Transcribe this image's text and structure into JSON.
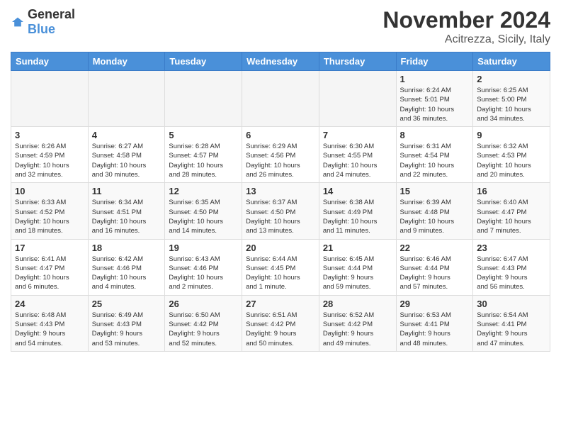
{
  "logo": {
    "general": "General",
    "blue": "Blue"
  },
  "title": "November 2024",
  "location": "Acitrezza, Sicily, Italy",
  "headers": [
    "Sunday",
    "Monday",
    "Tuesday",
    "Wednesday",
    "Thursday",
    "Friday",
    "Saturday"
  ],
  "weeks": [
    [
      {
        "num": "",
        "info": ""
      },
      {
        "num": "",
        "info": ""
      },
      {
        "num": "",
        "info": ""
      },
      {
        "num": "",
        "info": ""
      },
      {
        "num": "",
        "info": ""
      },
      {
        "num": "1",
        "info": "Sunrise: 6:24 AM\nSunset: 5:01 PM\nDaylight: 10 hours\nand 36 minutes."
      },
      {
        "num": "2",
        "info": "Sunrise: 6:25 AM\nSunset: 5:00 PM\nDaylight: 10 hours\nand 34 minutes."
      }
    ],
    [
      {
        "num": "3",
        "info": "Sunrise: 6:26 AM\nSunset: 4:59 PM\nDaylight: 10 hours\nand 32 minutes."
      },
      {
        "num": "4",
        "info": "Sunrise: 6:27 AM\nSunset: 4:58 PM\nDaylight: 10 hours\nand 30 minutes."
      },
      {
        "num": "5",
        "info": "Sunrise: 6:28 AM\nSunset: 4:57 PM\nDaylight: 10 hours\nand 28 minutes."
      },
      {
        "num": "6",
        "info": "Sunrise: 6:29 AM\nSunset: 4:56 PM\nDaylight: 10 hours\nand 26 minutes."
      },
      {
        "num": "7",
        "info": "Sunrise: 6:30 AM\nSunset: 4:55 PM\nDaylight: 10 hours\nand 24 minutes."
      },
      {
        "num": "8",
        "info": "Sunrise: 6:31 AM\nSunset: 4:54 PM\nDaylight: 10 hours\nand 22 minutes."
      },
      {
        "num": "9",
        "info": "Sunrise: 6:32 AM\nSunset: 4:53 PM\nDaylight: 10 hours\nand 20 minutes."
      }
    ],
    [
      {
        "num": "10",
        "info": "Sunrise: 6:33 AM\nSunset: 4:52 PM\nDaylight: 10 hours\nand 18 minutes."
      },
      {
        "num": "11",
        "info": "Sunrise: 6:34 AM\nSunset: 4:51 PM\nDaylight: 10 hours\nand 16 minutes."
      },
      {
        "num": "12",
        "info": "Sunrise: 6:35 AM\nSunset: 4:50 PM\nDaylight: 10 hours\nand 14 minutes."
      },
      {
        "num": "13",
        "info": "Sunrise: 6:37 AM\nSunset: 4:50 PM\nDaylight: 10 hours\nand 13 minutes."
      },
      {
        "num": "14",
        "info": "Sunrise: 6:38 AM\nSunset: 4:49 PM\nDaylight: 10 hours\nand 11 minutes."
      },
      {
        "num": "15",
        "info": "Sunrise: 6:39 AM\nSunset: 4:48 PM\nDaylight: 10 hours\nand 9 minutes."
      },
      {
        "num": "16",
        "info": "Sunrise: 6:40 AM\nSunset: 4:47 PM\nDaylight: 10 hours\nand 7 minutes."
      }
    ],
    [
      {
        "num": "17",
        "info": "Sunrise: 6:41 AM\nSunset: 4:47 PM\nDaylight: 10 hours\nand 6 minutes."
      },
      {
        "num": "18",
        "info": "Sunrise: 6:42 AM\nSunset: 4:46 PM\nDaylight: 10 hours\nand 4 minutes."
      },
      {
        "num": "19",
        "info": "Sunrise: 6:43 AM\nSunset: 4:46 PM\nDaylight: 10 hours\nand 2 minutes."
      },
      {
        "num": "20",
        "info": "Sunrise: 6:44 AM\nSunset: 4:45 PM\nDaylight: 10 hours\nand 1 minute."
      },
      {
        "num": "21",
        "info": "Sunrise: 6:45 AM\nSunset: 4:44 PM\nDaylight: 9 hours\nand 59 minutes."
      },
      {
        "num": "22",
        "info": "Sunrise: 6:46 AM\nSunset: 4:44 PM\nDaylight: 9 hours\nand 57 minutes."
      },
      {
        "num": "23",
        "info": "Sunrise: 6:47 AM\nSunset: 4:43 PM\nDaylight: 9 hours\nand 56 minutes."
      }
    ],
    [
      {
        "num": "24",
        "info": "Sunrise: 6:48 AM\nSunset: 4:43 PM\nDaylight: 9 hours\nand 54 minutes."
      },
      {
        "num": "25",
        "info": "Sunrise: 6:49 AM\nSunset: 4:43 PM\nDaylight: 9 hours\nand 53 minutes."
      },
      {
        "num": "26",
        "info": "Sunrise: 6:50 AM\nSunset: 4:42 PM\nDaylight: 9 hours\nand 52 minutes."
      },
      {
        "num": "27",
        "info": "Sunrise: 6:51 AM\nSunset: 4:42 PM\nDaylight: 9 hours\nand 50 minutes."
      },
      {
        "num": "28",
        "info": "Sunrise: 6:52 AM\nSunset: 4:42 PM\nDaylight: 9 hours\nand 49 minutes."
      },
      {
        "num": "29",
        "info": "Sunrise: 6:53 AM\nSunset: 4:41 PM\nDaylight: 9 hours\nand 48 minutes."
      },
      {
        "num": "30",
        "info": "Sunrise: 6:54 AM\nSunset: 4:41 PM\nDaylight: 9 hours\nand 47 minutes."
      }
    ]
  ]
}
